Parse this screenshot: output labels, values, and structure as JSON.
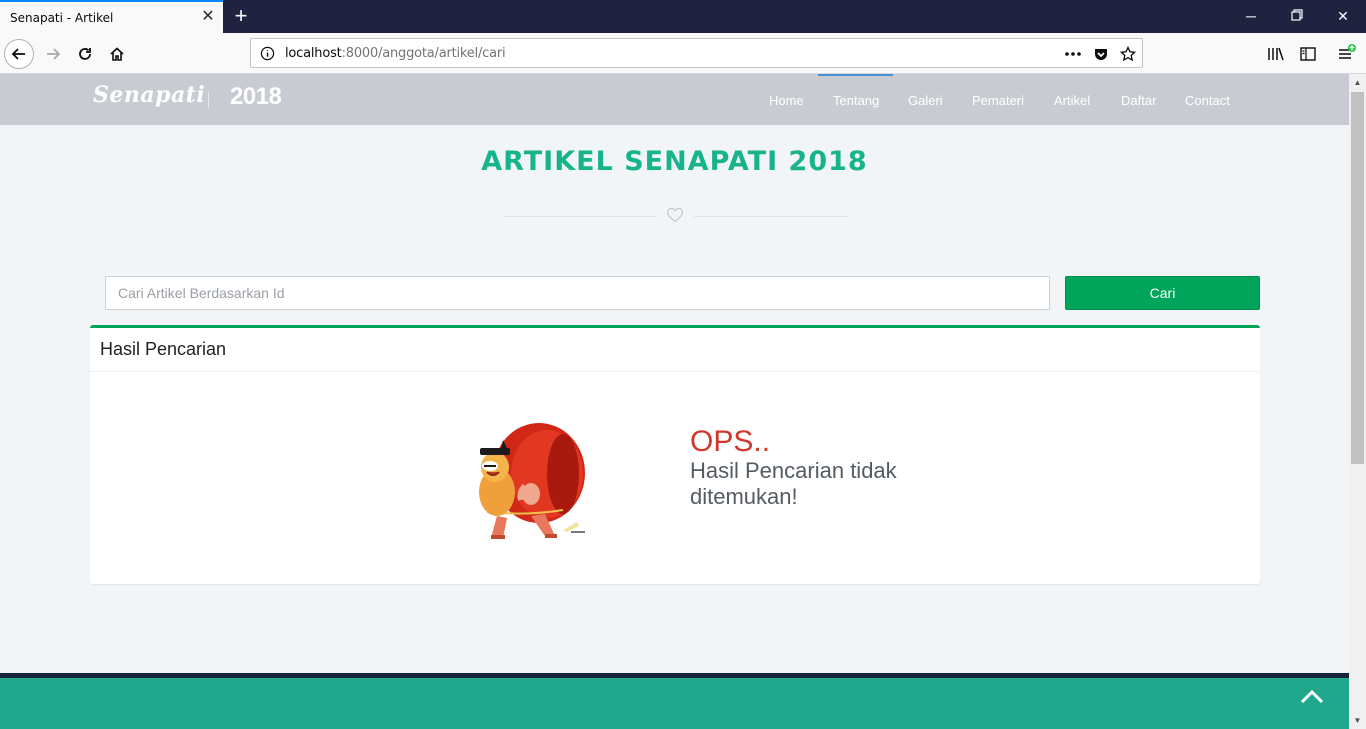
{
  "browser": {
    "tab_title": "Senapati - Artikel",
    "url_host": "localhost",
    "url_path": ":8000/anggota/artikel/cari"
  },
  "site": {
    "logo_script": "Senapati",
    "logo_year": "2018",
    "nav": [
      "Home",
      "Tentang",
      "Galeri",
      "Pemateri",
      "Artikel",
      "Daftar",
      "Contact"
    ]
  },
  "main": {
    "title": "ARTIKEL SENAPATI 2018",
    "search_placeholder": "Cari Artikel Berdasarkan Id",
    "search_button": "Cari",
    "panel_title": "Hasil Pencarian",
    "empty_title": "OPS..",
    "empty_message": "Hasil Pencarian tidak ditemukan!"
  },
  "colors": {
    "accent_green": "#00a45a",
    "title_teal": "#17b48c",
    "error_red": "#d0392b",
    "footer_teal": "#1fa88c"
  }
}
